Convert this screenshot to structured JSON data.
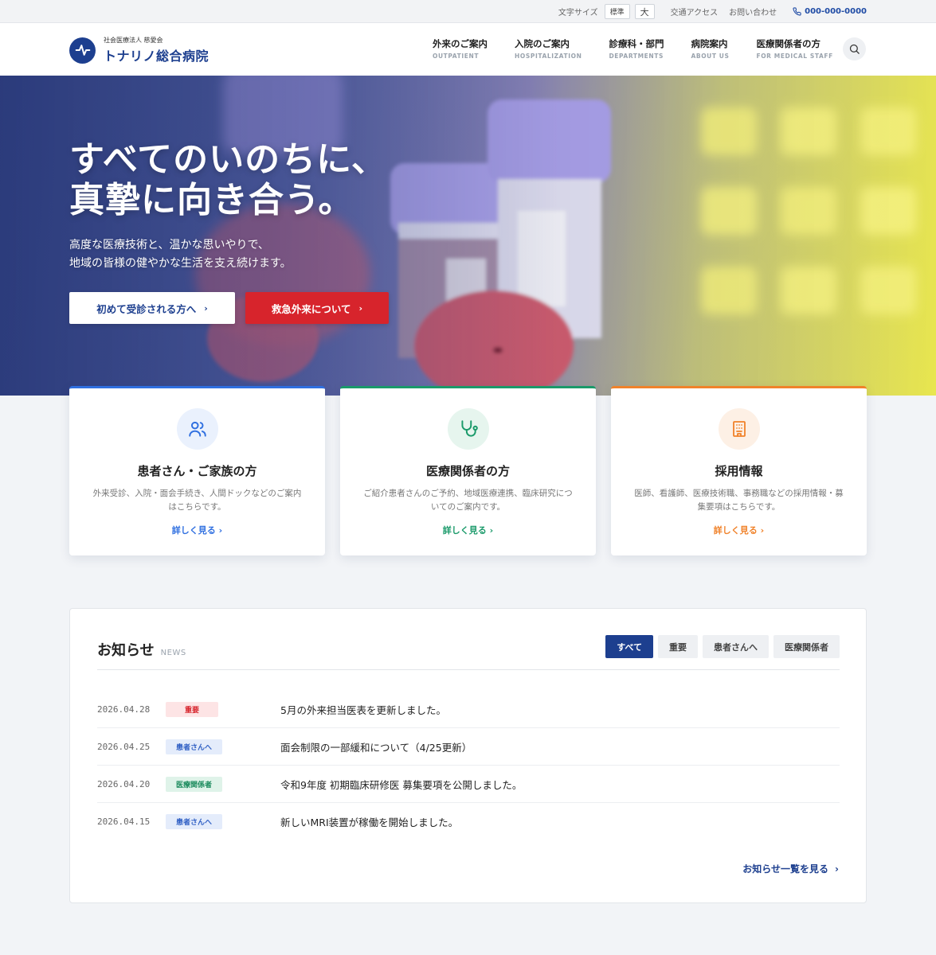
{
  "utility": {
    "font_size_label": "文字サイズ",
    "font_normal": "標準",
    "font_large": "大",
    "access": "交通アクセス",
    "contact": "お問い合わせ",
    "phone": "000-000-0000"
  },
  "header": {
    "logo_sub": "社会医療法人 慈愛会",
    "logo_main": "トナリノ総合病院",
    "nav": [
      {
        "jp": "外来のご案内",
        "en": "OUTPATIENT"
      },
      {
        "jp": "入院のご案内",
        "en": "HOSPITALIZATION"
      },
      {
        "jp": "診療科・部門",
        "en": "DEPARTMENTS"
      },
      {
        "jp": "病院案内",
        "en": "ABOUT US"
      },
      {
        "jp": "医療関係者の方",
        "en": "FOR MEDICAL STAFF"
      }
    ]
  },
  "hero": {
    "title_line1": "すべてのいのちに、",
    "title_line2": "真摯に向き合う。",
    "lead_line1": "高度な医療技術と、温かな思いやりで、",
    "lead_line2": "地域の皆様の健やかな生活を支え続けます。",
    "btn_first": "初めて受診される方へ",
    "btn_emergency": "救急外来について"
  },
  "cards": [
    {
      "title": "患者さん・ご家族の方",
      "desc": "外来受診、入院・面会手続き、人間ドックなどのご案内はこちらです。",
      "link": "詳しく見る",
      "icon": "users-icon"
    },
    {
      "title": "医療関係者の方",
      "desc": "ご紹介患者さんのご予約、地域医療連携、臨床研究についてのご案内です。",
      "link": "詳しく見る",
      "icon": "stethoscope-icon"
    },
    {
      "title": "採用情報",
      "desc": "医師、看護師、医療技術職、事務職などの採用情報・募集要項はこちらです。",
      "link": "詳しく見る",
      "icon": "building-icon"
    }
  ],
  "news": {
    "title": "お知らせ",
    "title_en": "NEWS",
    "tabs": [
      "すべて",
      "重要",
      "患者さんへ",
      "医療関係者"
    ],
    "items": [
      {
        "date": "2026.04.28",
        "badge": "重要",
        "badge_type": "important",
        "text": "5月の外来担当医表を更新しました。"
      },
      {
        "date": "2026.04.25",
        "badge": "患者さんへ",
        "badge_type": "patient",
        "text": "面会制限の一部緩和について（4/25更新）"
      },
      {
        "date": "2026.04.20",
        "badge": "医療関係者",
        "badge_type": "medical",
        "text": "令和9年度 初期臨床研修医 募集要項を公開しました。"
      },
      {
        "date": "2026.04.15",
        "badge": "患者さんへ",
        "badge_type": "patient",
        "text": "新しいMRI装置が稼働を開始しました。"
      }
    ],
    "more": "お知らせ一覧を見る"
  },
  "colors": {
    "brand": "#1d3f8f",
    "emergency": "#d7242c",
    "patient_accent": "#2f6fe0",
    "medical_accent": "#1a9a6a",
    "recruit_accent": "#f0822a"
  }
}
